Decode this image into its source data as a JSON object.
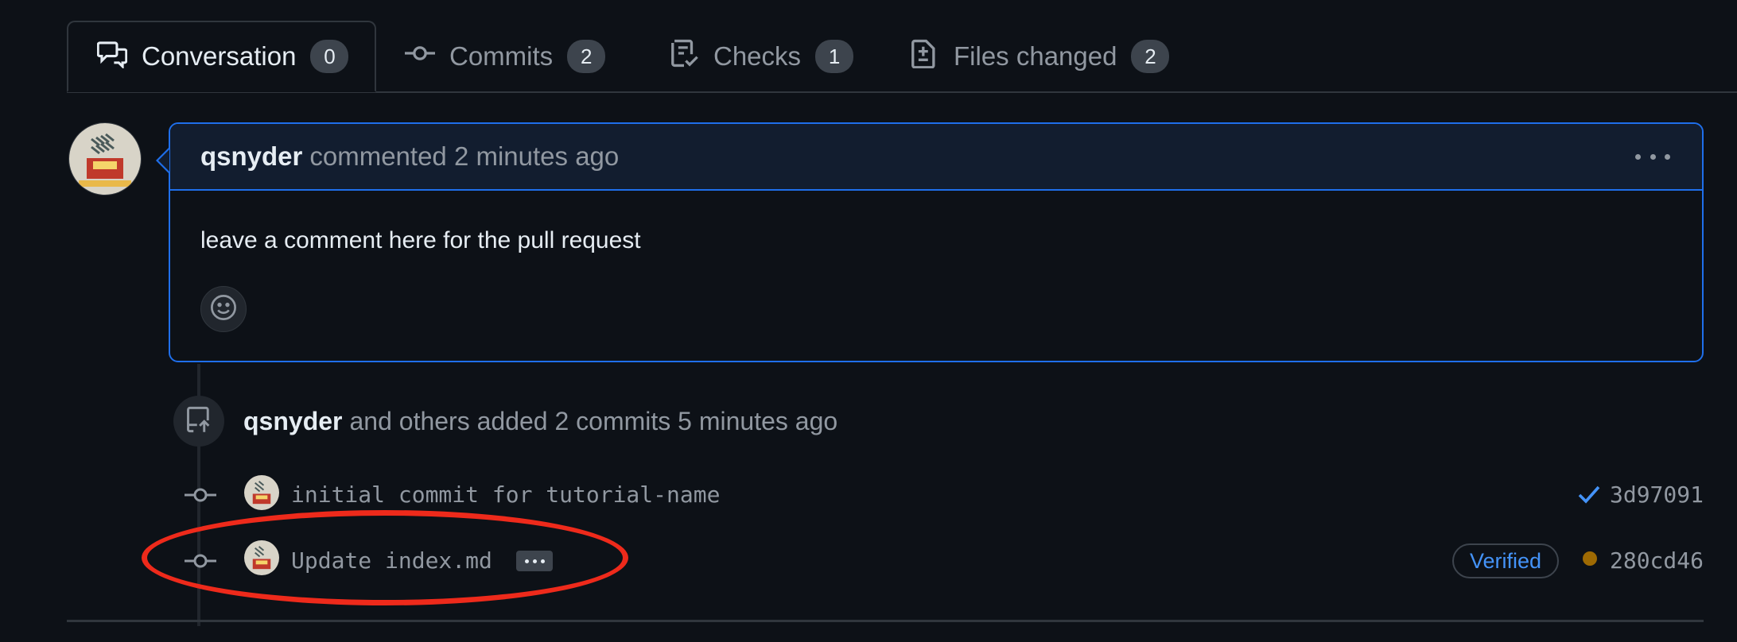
{
  "tabs": [
    {
      "label": "Conversation",
      "count": "0",
      "icon": "comment-discussion-icon"
    },
    {
      "label": "Commits",
      "count": "2",
      "icon": "git-commit-icon"
    },
    {
      "label": "Checks",
      "count": "1",
      "icon": "checklist-icon"
    },
    {
      "label": "Files changed",
      "count": "2",
      "icon": "file-diff-icon"
    }
  ],
  "comment": {
    "author": "qsnyder",
    "meta": "commented 2 minutes ago",
    "body": "leave a comment here for the pull request",
    "header_bg": "#121d2f",
    "border_color": "#1f6feb"
  },
  "event": {
    "author": "qsnyder",
    "text": "and others added 2 commits 5 minutes ago"
  },
  "commits": [
    {
      "message": "initial commit for tutorial-name",
      "sha": "3d97091",
      "status": "success"
    },
    {
      "message": "Update index.md",
      "sha": "280cd46",
      "badge": "Verified",
      "status": "pending"
    }
  ],
  "colors": {
    "background": "#0d1117",
    "link": "#4493f8",
    "pending": "#9e6a03",
    "annotation": "#ee2a1b"
  }
}
